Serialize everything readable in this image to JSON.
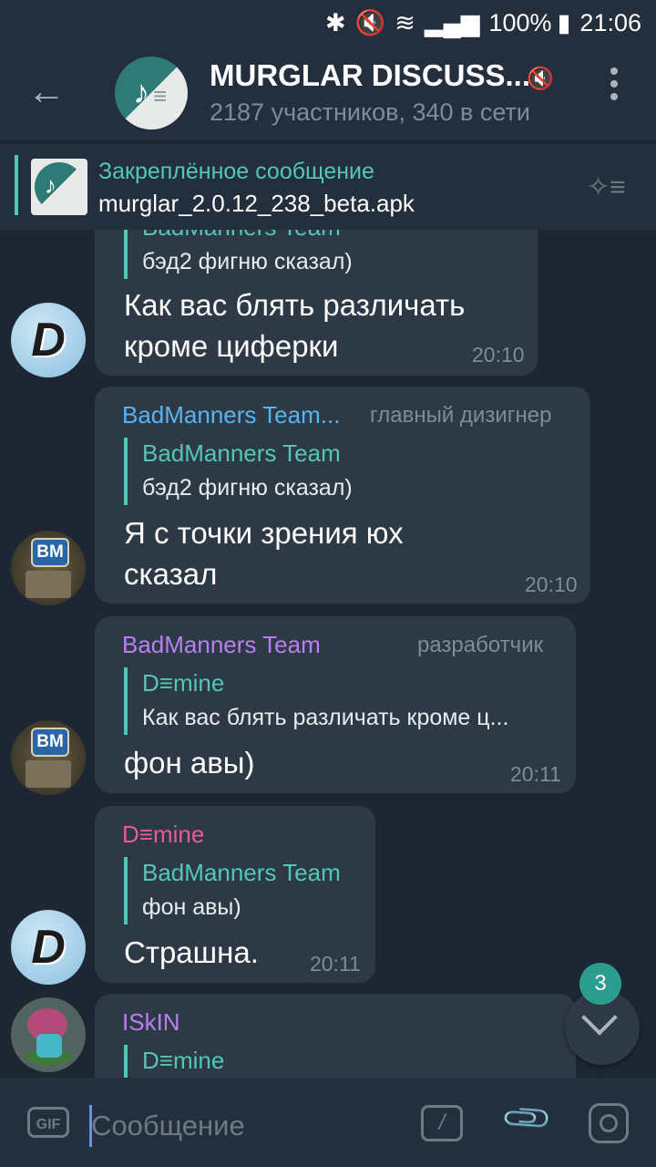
{
  "status_bar": {
    "icons": [
      "bluetooth-icon",
      "mute-icon",
      "wifi-icon",
      "signal-icon"
    ],
    "battery": "100%",
    "time": "21:06"
  },
  "header": {
    "title": "MURGLAR DISCUSS...",
    "subtitle": "2187 участников, 340 в сети",
    "muted": true
  },
  "pinned": {
    "label": "Закреплённое сообщение",
    "text": "murglar_2.0.12_238_beta.apk"
  },
  "messages": [
    {
      "partial_top": true,
      "reply_name": "BadManners Team",
      "reply_text": "бэд2 фигню сказал)",
      "text_lines": [
        "Как вас блять различать",
        "кроме циферки"
      ],
      "time": "20:10"
    },
    {
      "author": "BadManners Team...",
      "author_color": "#5ab3f0",
      "role": "главный дизигнер",
      "reply_name": "BadManners Team",
      "reply_text": "бэд2 фигню сказал)",
      "text_lines": [
        "Я с точки зрения юх",
        "сказал"
      ],
      "time": "20:10"
    },
    {
      "author": "BadManners Team",
      "author_color": "#b87ff0",
      "role": "разработчик",
      "reply_name": "D≡mine",
      "reply_text": "Как вас блять различать кроме ц...",
      "text_lines": [
        "фон авы)"
      ],
      "time": "20:11"
    },
    {
      "author": "D≡mine",
      "author_color": "#e85a9c",
      "reply_name": "BadManners Team",
      "reply_text": "фон авы)",
      "text_lines": [
        "Страшна."
      ],
      "time": "20:11"
    },
    {
      "author": "ISkIN",
      "author_color": "#b87ff0",
      "reply_name": "D≡mine"
    }
  ],
  "avatars": {
    "d": "D",
    "bm": "BM"
  },
  "scroll_badge": "3",
  "input": {
    "gif_label": "GIF",
    "placeholder": "Сообщение",
    "command_label": "/"
  }
}
